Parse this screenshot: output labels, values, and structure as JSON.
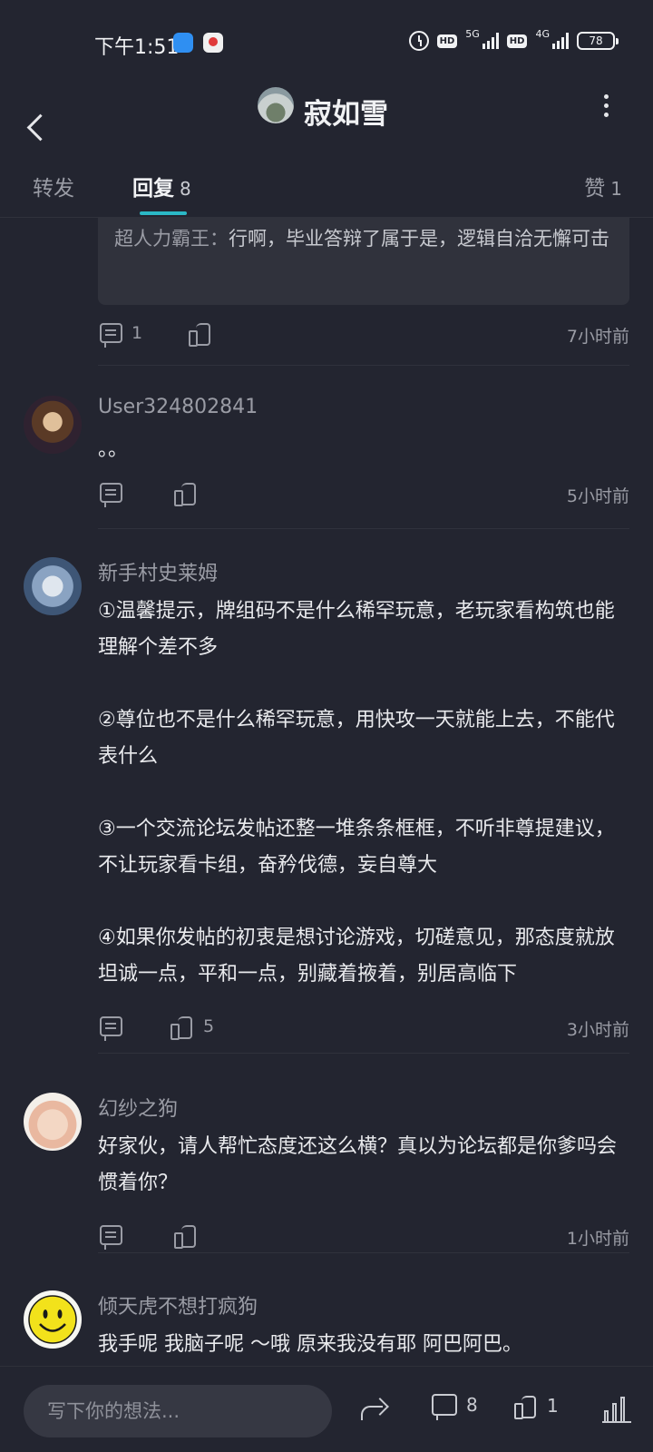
{
  "status_bar": {
    "time": "下午1:51",
    "net_1": "5G",
    "net_2": "4G",
    "hd": "HD",
    "battery": "78"
  },
  "header": {
    "title": "寂如雪"
  },
  "tabs": {
    "forward": "转发",
    "reply": "回复",
    "reply_count": "8",
    "like": "赞",
    "like_count": "1"
  },
  "quote": {
    "author": "超人力霸王：",
    "text": "行啊，毕业答辩了属于是，逻辑自洽无懈可击",
    "comment_count": "1",
    "time": "7小时前"
  },
  "comments": [
    {
      "username": "User324802841",
      "text": "。。",
      "like_count": "",
      "time": "5小时前"
    },
    {
      "username": "新手村史莱姆",
      "text": "①温馨提示，牌组码不是什么稀罕玩意，老玩家看构筑也能理解个差不多\n\n②尊位也不是什么稀罕玩意，用快攻一天就能上去，不能代表什么\n\n③一个交流论坛发帖还整一堆条条框框，不听非尊提建议，不让玩家看卡组，奋矜伐德，妄自尊大\n\n④如果你发帖的初衷是想讨论游戏，切磋意见，那态度就放坦诚一点，平和一点，别藏着掖着，别居高临下",
      "like_count": "5",
      "time": "3小时前"
    },
    {
      "username": "幻纱之狗",
      "text": "好家伙，请人帮忙态度还这么横？真以为论坛都是你爹吗会惯着你？",
      "like_count": "",
      "time": "1小时前"
    },
    {
      "username": "倾天虎不想打疯狗",
      "text": "我手呢 我脑子呢 ～哦 原来我没有耶 阿巴阿巴。",
      "like_count": "",
      "time": ""
    }
  ],
  "bottom_bar": {
    "input_placeholder": "写下你的想法...",
    "comment_count": "8",
    "like_count": "1"
  }
}
